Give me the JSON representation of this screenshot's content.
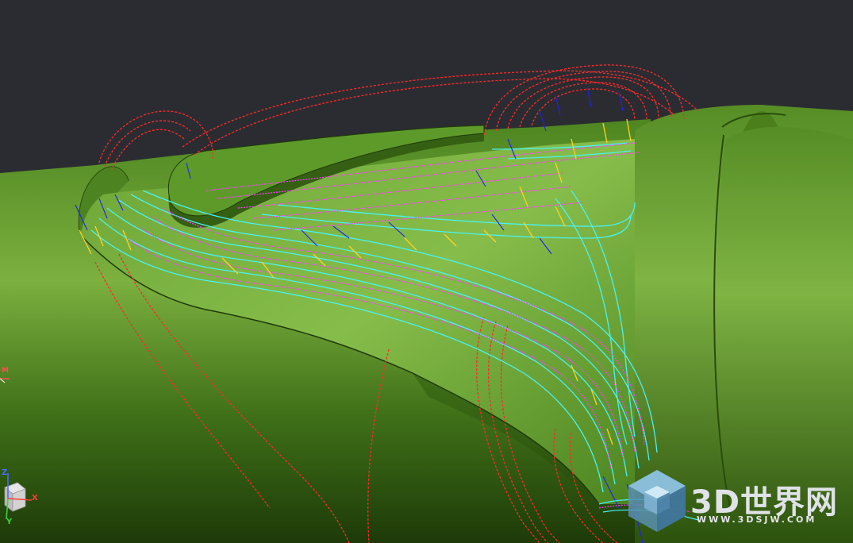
{
  "viewport": {
    "background": "#2b2c31",
    "model_color": "#5f9a2a",
    "toolpath_colors": {
      "rapid": "#ff2a2a",
      "cut": "#49f2f2",
      "feed": "#ff3cff",
      "lead": "#ffd21f",
      "tool_axis": "#2222ee"
    }
  },
  "triad": {
    "x_label": "X",
    "y_label": "Y",
    "z_label": "Z",
    "x_color": "#ff3b3b",
    "y_color": "#40d040",
    "z_color": "#4a6bff"
  },
  "side_marker": {
    "label": "M"
  },
  "watermark": {
    "title": "3D世界网",
    "url": "WWW.3DSJW.COM",
    "logo_icon": "cube-logo-icon"
  }
}
